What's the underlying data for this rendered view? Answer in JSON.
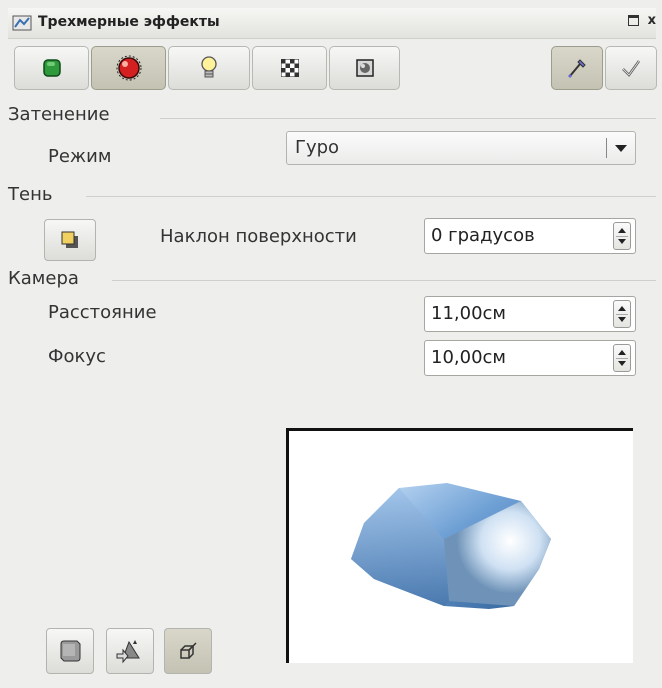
{
  "window": {
    "title": "Трехмерные эффекты",
    "close_glyph": "x"
  },
  "toolbar": {
    "buttons": [
      {
        "icon": "geometry-cube-icon",
        "active": false
      },
      {
        "icon": "shading-sphere-icon",
        "active": true
      },
      {
        "icon": "illumination-bulb-icon",
        "active": false
      },
      {
        "icon": "textures-checker-icon",
        "active": false
      },
      {
        "icon": "material-icon",
        "active": false
      }
    ],
    "right_buttons": [
      {
        "icon": "pipette-icon",
        "active": true
      },
      {
        "icon": "apply-checkmark-icon",
        "active": false
      }
    ]
  },
  "shading": {
    "section_label": "Затенение",
    "mode_label": "Режим",
    "mode_value": "Гуро"
  },
  "shadow": {
    "section_label": "Тень",
    "surface_angle_label": "Наклон поверхности",
    "surface_angle_value": "0 градусов"
  },
  "camera": {
    "section_label": "Камера",
    "distance_label": "Расстояние",
    "distance_value": "11,00см",
    "focus_label": "Фокус",
    "focus_value": "10,00см"
  },
  "bottom_buttons": [
    {
      "icon": "convert-to-3d-icon"
    },
    {
      "icon": "convert-to-rotation-object-icon"
    },
    {
      "icon": "perspective-toggle-icon",
      "active": true
    }
  ],
  "colors": {
    "panel_bg": "#eeeeec",
    "active_button": "#c9c7b8",
    "preview_bg": "#ffffff"
  }
}
